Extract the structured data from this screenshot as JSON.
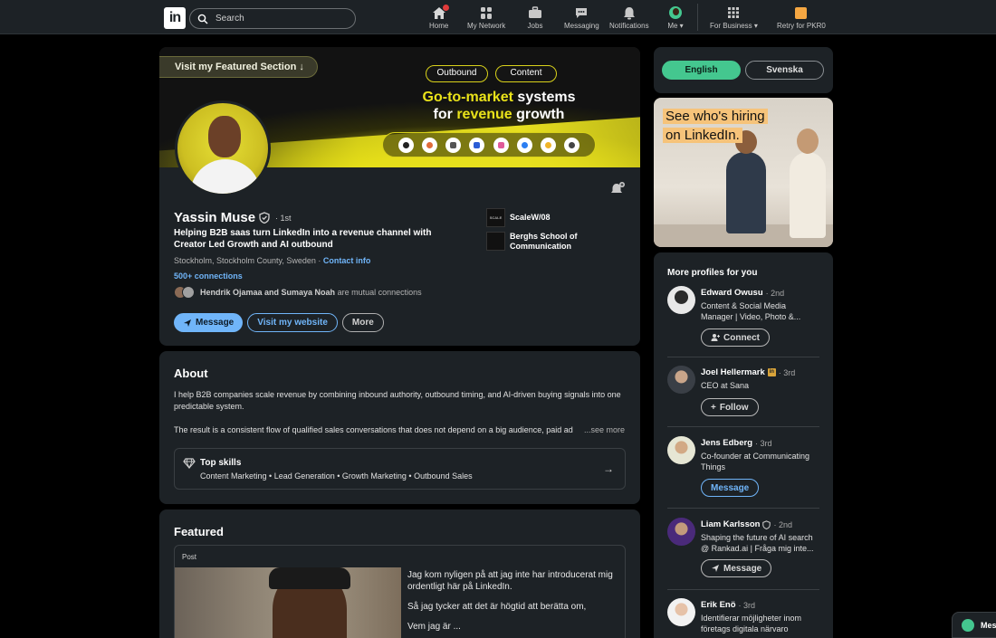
{
  "nav": {
    "search_placeholder": "Search",
    "items": [
      {
        "label": "Home",
        "icon": "home-icon"
      },
      {
        "label": "My Network",
        "icon": "network-icon"
      },
      {
        "label": "Jobs",
        "icon": "briefcase-icon"
      },
      {
        "label": "Messaging",
        "icon": "messaging-icon"
      },
      {
        "label": "Notifications",
        "icon": "bell-icon"
      },
      {
        "label": "Me",
        "icon": "avatar"
      },
      {
        "label": "For Business",
        "icon": "grid-icon"
      },
      {
        "label": "Retry for PKR0",
        "icon": "premium-icon"
      }
    ]
  },
  "banner": {
    "featured_pill": "Visit my Featured Section ↓",
    "tag1": "Outbound",
    "tag2": "Content",
    "line1a": "Go-to-market",
    "line1b": " systems",
    "line2a": "for ",
    "line2b": "revenue",
    "line2c": " growth"
  },
  "profile": {
    "name": "Yassin Muse",
    "degree": "· 1st",
    "headline": "Helping B2B saas turn LinkedIn into a revenue channel with Creator Led Growth and AI outbound",
    "location": "Stockholm, Stockholm County, Sweden · ",
    "contact_info": "Contact info",
    "connections": "500+ connections",
    "mutual_names": "Hendrik Ojamaa and Sumaya Noah",
    "mutual_suffix": " are mutual connections",
    "btn_message": "Message",
    "btn_website": "Visit my website",
    "btn_more": "More",
    "experience": [
      {
        "name": "ScaleW/08",
        "logo_text": "SCALE"
      },
      {
        "name": "Berghs School of Communication",
        "logo_text": ""
      }
    ]
  },
  "about": {
    "title": "About",
    "p1": "I help B2B companies scale revenue by combining inbound authority, outbound timing, and AI-driven buying signals into one predictable system.",
    "p2": "The result is a consistent flow of qualified sales conversations that does not depend on a big audience, paid ad",
    "see_more": "...see more",
    "skills_title": "Top skills",
    "skills": "Content Marketing • Lead Generation • Growth Marketing • Outbound Sales"
  },
  "featured": {
    "title": "Featured",
    "post_label": "Post",
    "post_p1": "Jag kom nyligen på att jag inte har introducerat mig ordentligt här på LinkedIn.",
    "post_p2": "Så jag tycker att det är högtid att berätta om,",
    "post_p3": "Vem jag är ..."
  },
  "language": {
    "en": "English",
    "sv": "Svenska"
  },
  "ad": {
    "line1": "See who's hiring",
    "line2": "on LinkedIn."
  },
  "more_profiles": {
    "title": "More profiles for you",
    "people": [
      {
        "name": "Edward Owusu",
        "degree": "· 2nd",
        "desc": "Content & Social Media Manager | Video, Photo &...",
        "button": "Connect"
      },
      {
        "name": "Joel Hellermark",
        "degree": "· 3rd",
        "desc": "CEO at Sana",
        "button": "Follow"
      },
      {
        "name": "Jens Edberg",
        "degree": "· 3rd",
        "desc": "Co-founder at Communicating Things",
        "button": "Message"
      },
      {
        "name": "Liam Karlsson",
        "degree": "· 2nd",
        "desc": "Shaping the future of AI search @ Rankad.ai | Fråga mig inte...",
        "button": "Message"
      },
      {
        "name": "Erik Enö",
        "degree": "· 3rd",
        "desc": "Identifierar möjligheter inom företags digitala närvaro",
        "button": ""
      }
    ]
  },
  "messaging_tab": {
    "label": "Mes"
  },
  "colors": {
    "accent_blue": "#70b5f9",
    "accent_green": "#44c78f",
    "banner_yellow": "#e9e21a",
    "card_bg": "#1d2226"
  }
}
